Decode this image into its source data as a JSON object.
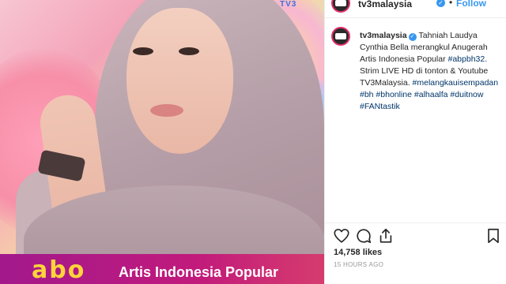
{
  "post": {
    "badge_text": "TV3",
    "banner_logo": "abo",
    "banner_title": "Artis Indonesia Popular"
  },
  "header": {
    "username": "tv3malaysia",
    "verified_mark": "✓",
    "separator": "•",
    "follow_label": "Follow"
  },
  "caption": {
    "username": "tv3malaysia",
    "verified_mark": "✓",
    "text": "Tahniah Laudya Cynthia Bella merangkul Anugerah Artis Indonesia Popular",
    "hashtag_1": "#abpbh32",
    "text_2": ". Strim LIVE HD di tonton & Youtube TV3Malaysia.",
    "hashtags": "#melangkauisempadan #bh #bhonline #alhaalfa #duitnow #FANtastik"
  },
  "stats": {
    "likes": "14,758 likes",
    "timestamp": "15 HOURS AGO"
  },
  "icons": {
    "like": "heart-icon",
    "comment": "comment-icon",
    "share": "share-icon",
    "save": "bookmark-icon"
  },
  "colors": {
    "link": "#3897f0",
    "hashtag": "#003569",
    "banner": "#b51984",
    "text": "#262626"
  }
}
